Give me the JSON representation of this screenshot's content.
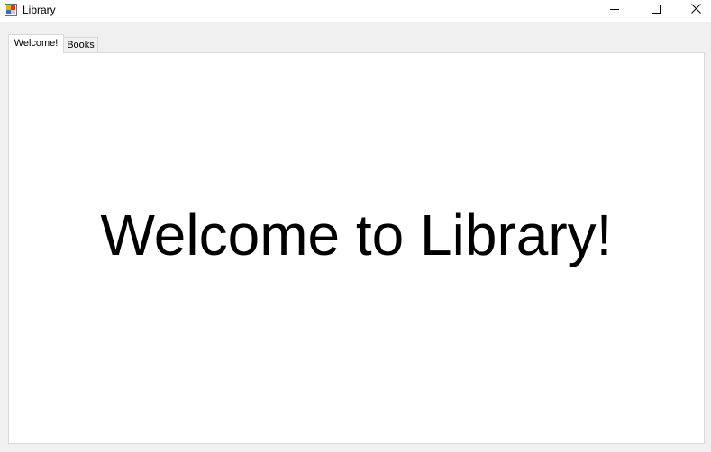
{
  "window": {
    "title": "Library",
    "app_icon": "application-icon",
    "controls": {
      "minimize_icon": "minimize-icon",
      "maximize_icon": "maximize-icon",
      "close_icon": "close-icon"
    }
  },
  "tabs": [
    {
      "label": "Welcome!",
      "selected": true
    },
    {
      "label": "Books",
      "selected": false
    }
  ],
  "welcome_page": {
    "message": "Welcome to Library!"
  },
  "colors": {
    "window_background": "#f0f0f0",
    "page_background": "#ffffff",
    "border": "#d9d9d9",
    "text": "#000000"
  }
}
